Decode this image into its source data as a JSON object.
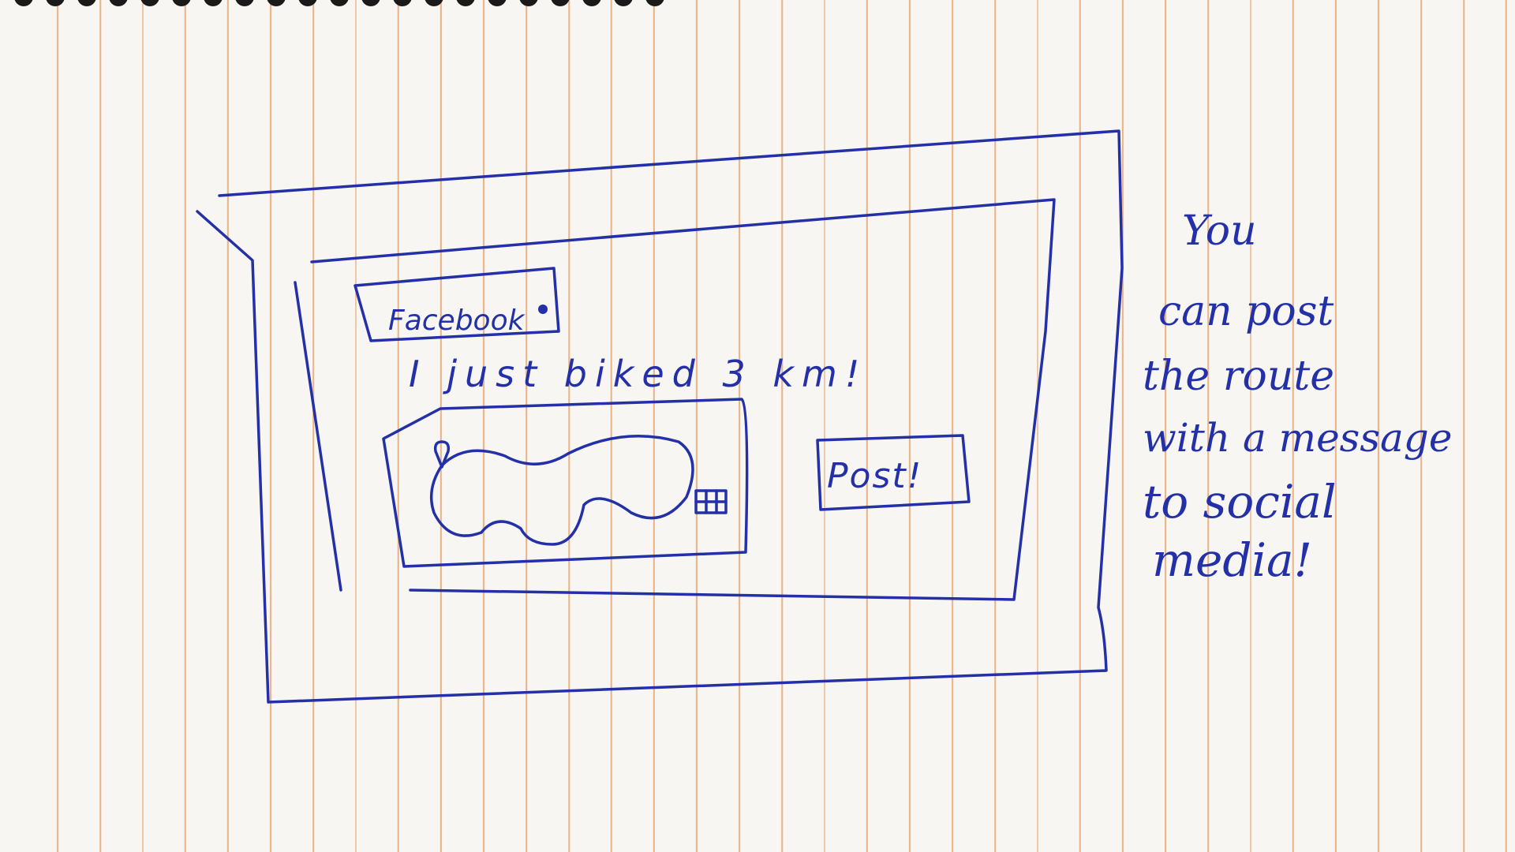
{
  "sketch": {
    "platform_label": "Facebook",
    "message_text": "I just biked 3 km!",
    "post_button_label": "Post!"
  },
  "side_note": {
    "lines": [
      "You",
      "can post",
      "the route",
      "with a message",
      "to social",
      "media!"
    ]
  },
  "colors": {
    "ink": "#2430a8",
    "paper": "#f7f6f2",
    "ruled_lines": "#e8b58a"
  }
}
